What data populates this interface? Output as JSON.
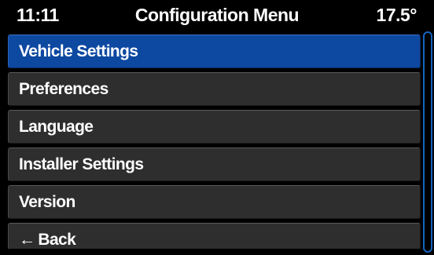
{
  "header": {
    "time": "11:11",
    "title": "Configuration Menu",
    "temperature": "17.5°"
  },
  "menu": {
    "selected_index": 0,
    "items": [
      {
        "label": "Vehicle Settings"
      },
      {
        "label": "Preferences"
      },
      {
        "label": "Language"
      },
      {
        "label": "Installer Settings"
      },
      {
        "label": "Version"
      }
    ],
    "back": {
      "arrow": "←",
      "label": "Back"
    }
  },
  "colors": {
    "background": "#000000",
    "item_background": "#2e2e2e",
    "selected_background": "#0d48a1",
    "scrollbar_accent": "#1565c0",
    "text": "#ffffff"
  }
}
